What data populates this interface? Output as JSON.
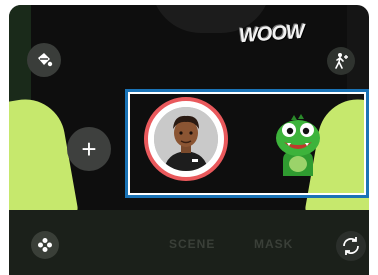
{
  "overlay_text": "WOOW",
  "modes": {
    "scene": "SCENE",
    "mask": "MASK"
  },
  "buttons": {
    "add_symbol": "+"
  },
  "colors": {
    "selection_ring": "#e9595c",
    "highlight_border": "#1a73b6",
    "sleeve": "#c6e86d",
    "dino_green": "#3db33b"
  },
  "icons": {
    "sticker": "sticker-bucket-icon",
    "body_pose": "walking-person-plus-icon",
    "effects": "flower-icon",
    "switch_camera": "rotate-camera-icon"
  }
}
